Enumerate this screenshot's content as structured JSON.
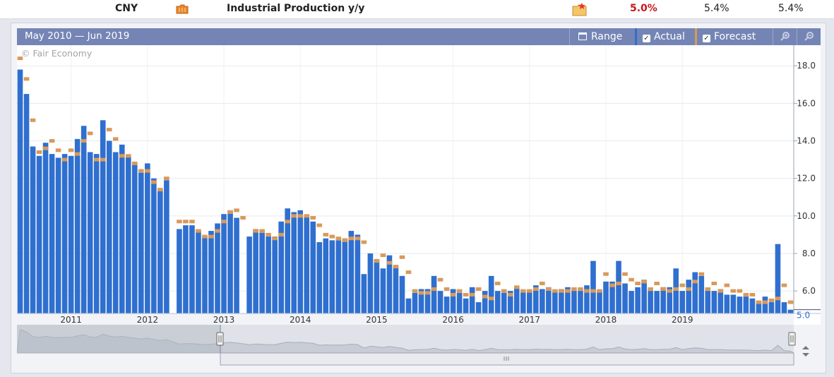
{
  "event_row": {
    "currency": "CNY",
    "impact_icon": "folder-impact-icon",
    "title": "Industrial Production y/y",
    "detail_icon": "detail-folder-icon",
    "actual": "5.0%",
    "forecast": "5.4%",
    "previous": "5.4%",
    "actual_color": "#c8161d"
  },
  "chart_header": {
    "range_text": "May 2010 — Jun 2019",
    "range_button": "Range",
    "actual_toggle": "Actual",
    "forecast_toggle": "Forecast",
    "zoom_in_icon": "zoom-in-icon",
    "zoom_out_icon": "zoom-out-icon"
  },
  "watermark": "© Fair Economy",
  "chart_data": {
    "type": "bar",
    "title": "",
    "xlabel": "",
    "ylabel": "",
    "ylim": [
      4.8,
      19.1
    ],
    "y_ticks": [
      "6.0",
      "8.0",
      "10.0",
      "12.0",
      "14.0",
      "16.0",
      "18.0"
    ],
    "x_ticks": [
      "2011",
      "2012",
      "2013",
      "2014",
      "2015",
      "2016",
      "2017",
      "2018",
      "2019"
    ],
    "last_value_label": "5.0",
    "grid": true,
    "colors": {
      "actual": "#2f6fcf",
      "forecast": "#d89a5a"
    },
    "series": [
      {
        "name": "Actual",
        "values": [
          17.8,
          16.5,
          13.7,
          13.2,
          13.9,
          13.3,
          13.1,
          13.3,
          13.2,
          14.1,
          14.8,
          13.4,
          13.3,
          15.1,
          14.0,
          13.4,
          13.8,
          13.2,
          12.8,
          12.3,
          12.8,
          12.0,
          11.4,
          11.9,
          null,
          9.3,
          9.5,
          9.5,
          9.2,
          8.9,
          9.2,
          9.6,
          10.1,
          10.3,
          9.9,
          null,
          8.9,
          9.3,
          9.1,
          8.9,
          8.9,
          9.7,
          10.4,
          10.2,
          10.3,
          10.0,
          9.7,
          8.6,
          8.8,
          8.7,
          8.7,
          8.8,
          9.2,
          9.0,
          6.9,
          8.0,
          7.7,
          7.2,
          7.9,
          7.3,
          6.8,
          5.6,
          5.9,
          6.1,
          6.1,
          6.8,
          6.0,
          5.7,
          6.1,
          5.9,
          5.6,
          6.2,
          5.4,
          6.0,
          6.8,
          6.0,
          5.9,
          6.0,
          6.2,
          6.0,
          6.0,
          6.3,
          6.1,
          6.2,
          6.0,
          6.1,
          6.2,
          6.0,
          6.0,
          6.3,
          7.6,
          6.0,
          6.5,
          6.5,
          7.6,
          6.4,
          6.0,
          6.2,
          6.6,
          6.0,
          6.0,
          6.2,
          6.2,
          7.2,
          6.0,
          6.6,
          7.0,
          6.8,
          6.0,
          6.0,
          6.1,
          5.8,
          5.8,
          5.7,
          5.7,
          5.6,
          5.4,
          5.7,
          5.4,
          8.5,
          5.4,
          5.0
        ]
      },
      {
        "name": "Forecast",
        "values": [
          18.4,
          17.3,
          15.1,
          13.4,
          13.6,
          14.0,
          13.5,
          13.0,
          13.5,
          13.3,
          14.0,
          14.4,
          13.0,
          13.0,
          14.6,
          14.1,
          13.2,
          13.2,
          12.8,
          12.4,
          12.4,
          11.8,
          11.4,
          12.0,
          null,
          9.7,
          9.7,
          9.7,
          9.2,
          8.9,
          8.9,
          9.2,
          9.7,
          10.2,
          10.3,
          9.9,
          null,
          9.2,
          9.2,
          9.0,
          8.8,
          9.0,
          9.7,
          10.0,
          10.0,
          10.0,
          9.9,
          9.5,
          9.0,
          8.9,
          8.8,
          8.7,
          8.8,
          8.8,
          8.6,
          null,
          7.6,
          7.9,
          7.5,
          7.3,
          7.8,
          7.0,
          6.0,
          5.9,
          5.9,
          6.1,
          6.6,
          6.1,
          5.8,
          6.0,
          5.8,
          5.8,
          6.1,
          5.7,
          5.6,
          6.4,
          6.0,
          5.8,
          6.2,
          6.0,
          6.0,
          6.1,
          6.4,
          6.1,
          6.0,
          6.0,
          6.0,
          6.1,
          6.1,
          6.0,
          6.0,
          6.0,
          6.9,
          6.3,
          6.4,
          6.9,
          6.6,
          6.4,
          6.5,
          6.1,
          6.4,
          6.1,
          6.0,
          6.1,
          6.3,
          6.1,
          6.5,
          6.9,
          6.1,
          6.4,
          6.0,
          6.3,
          6.0,
          6.0,
          5.8,
          5.8,
          5.4,
          5.4,
          5.5,
          5.6,
          6.3,
          5.4
        ]
      }
    ]
  }
}
